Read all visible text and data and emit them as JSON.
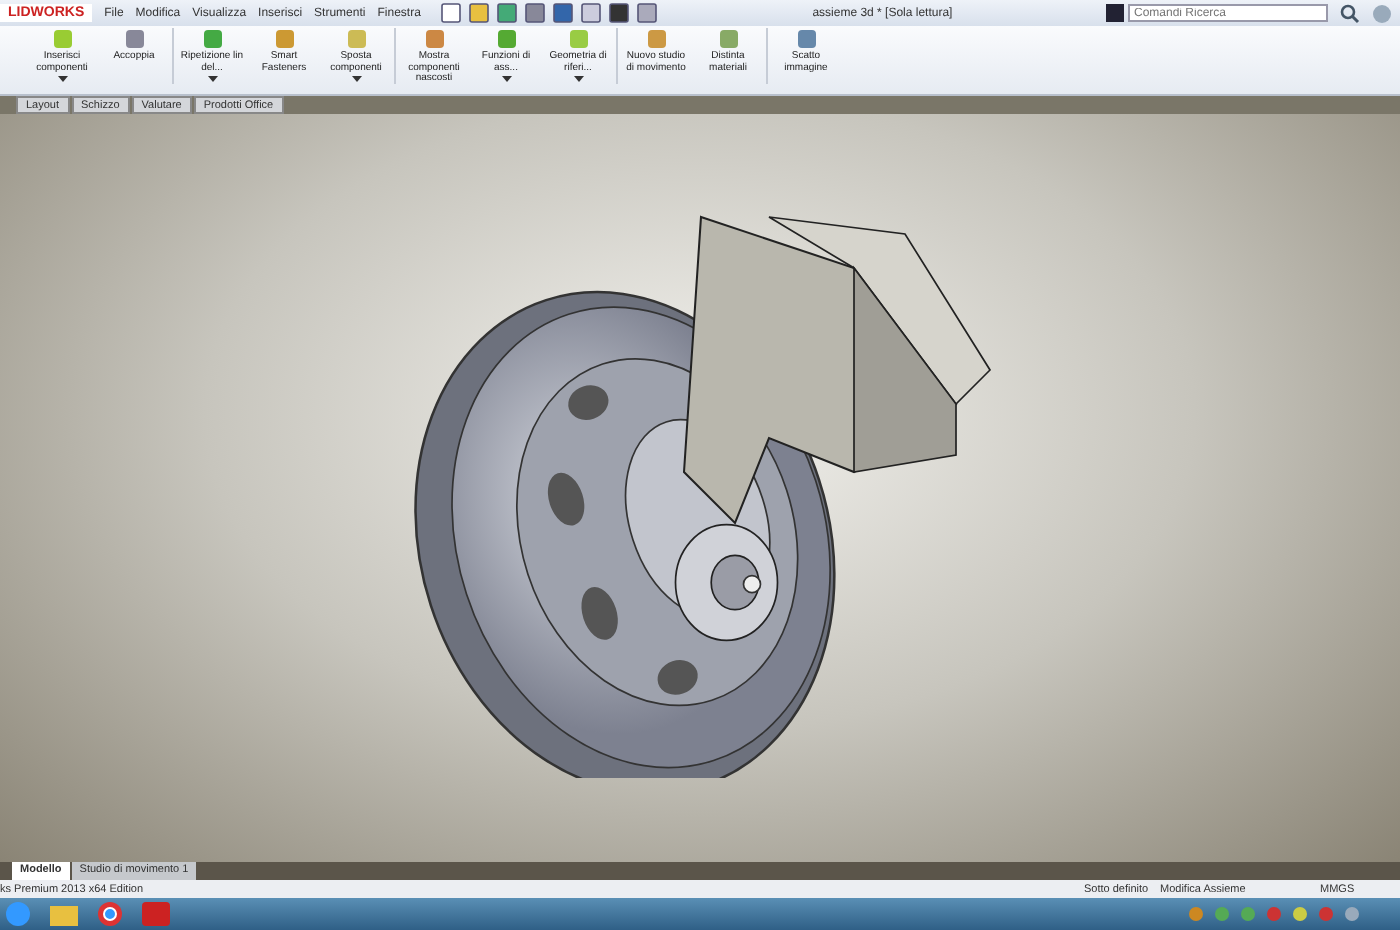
{
  "window": {
    "logo": "LIDWORKS",
    "title": "assieme 3d * [Sola lettura]"
  },
  "menu": [
    {
      "label": "File"
    },
    {
      "label": "Modifica"
    },
    {
      "label": "Visualizza"
    },
    {
      "label": "Inserisci"
    },
    {
      "label": "Strumenti"
    },
    {
      "label": "Finestra"
    }
  ],
  "search": {
    "placeholder": "Comandi Ricerca"
  },
  "ribbon": [
    {
      "label": "Inserisci componenti",
      "dropdown": true
    },
    {
      "label": "Accoppia",
      "dropdown": false
    },
    {
      "label": "Ripetizione lin del...",
      "dropdown": true
    },
    {
      "label": "Smart Fasteners",
      "dropdown": false
    },
    {
      "label": "Sposta componenti",
      "dropdown": true
    },
    {
      "label": "Mostra componenti nascosti",
      "dropdown": false
    },
    {
      "label": "Funzioni di ass...",
      "dropdown": true
    },
    {
      "label": "Geometria di riferi...",
      "dropdown": true
    },
    {
      "label": "Nuovo studio di movimento",
      "dropdown": false
    },
    {
      "label": "Distinta materiali",
      "dropdown": false
    },
    {
      "label": "Scatto immagine",
      "dropdown": false
    }
  ],
  "command_tabs": [
    {
      "label": "Layout",
      "selected": false
    },
    {
      "label": "Schizzo",
      "selected": false
    },
    {
      "label": "Valutare",
      "selected": false
    },
    {
      "label": "Prodotti Office",
      "selected": false
    }
  ],
  "model_tabs": [
    {
      "label": "Modello",
      "selected": true
    },
    {
      "label": "Studio di movimento 1",
      "selected": false
    }
  ],
  "status_bar": {
    "product": "ks Premium 2013 x64 Edition",
    "state": "Sotto definito",
    "mode": "Modifica Assieme",
    "units": "MMGS"
  }
}
